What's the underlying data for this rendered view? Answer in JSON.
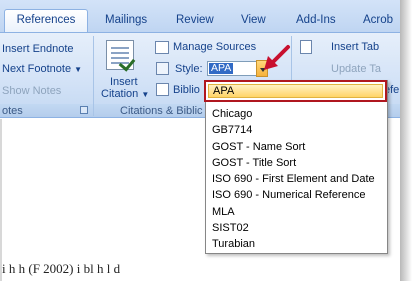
{
  "tabs": [
    {
      "label": "References",
      "active": true
    },
    {
      "label": "Mailings"
    },
    {
      "label": "Review"
    },
    {
      "label": "View"
    },
    {
      "label": "Add-Ins"
    },
    {
      "label": "Acrob"
    }
  ],
  "footnotes_group": {
    "insert_endnote": "Insert Endnote",
    "next_footnote": "Next Footnote",
    "show_notes": "Show Notes",
    "label": "otes"
  },
  "citations_group": {
    "insert_citation_line1": "Insert",
    "insert_citation_line2": "Citation",
    "manage_sources": "Manage Sources",
    "style_label": "Style:",
    "style_value": "APA",
    "bibliography": "Biblio",
    "label": "Citations & Biblic"
  },
  "captions_group": {
    "insert_table": "Insert Tab",
    "update_table": "Update Ta",
    "cross_ref": "efe"
  },
  "style_options": [
    "APA",
    "Chicago",
    "GB7714",
    "GOST - Name Sort",
    "GOST - Title Sort",
    "ISO 690 - First Element and Date",
    "ISO 690 - Numerical Reference",
    "MLA",
    "SIST02",
    "Turabian"
  ],
  "document": {
    "partial_text": "i   h     h    (F         2002)   i        bl     h    l     d"
  },
  "colors": {
    "highlight_border": "#b0171f",
    "arrow": "#c8102e",
    "ribbon_text": "#15428b"
  }
}
